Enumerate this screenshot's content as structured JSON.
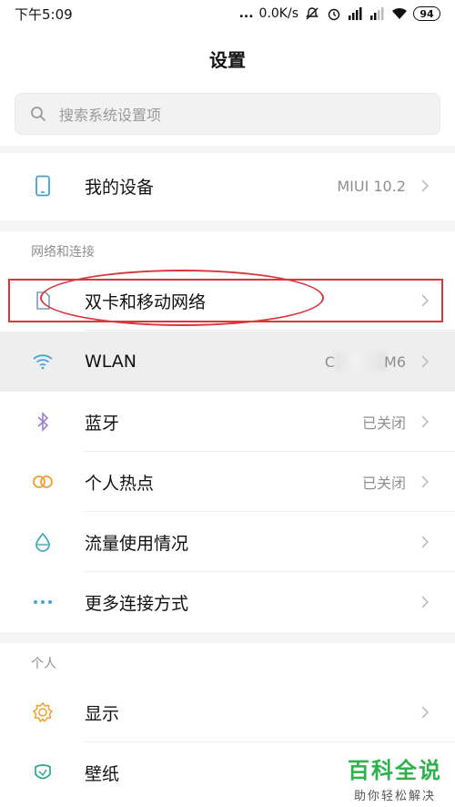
{
  "statusbar": {
    "time": "下午5:09",
    "dots": "...",
    "speed": "0.0K/s",
    "battery": "94"
  },
  "page": {
    "title": "设置"
  },
  "search": {
    "placeholder": "搜索系统设置项"
  },
  "device": {
    "label": "我的设备",
    "value": "MIUI 10.2"
  },
  "network": {
    "header": "网络和连接",
    "items": [
      {
        "label": "双卡和移动网络",
        "value": ""
      },
      {
        "label": "WLAN",
        "value_left": "C",
        "value_right": "M6"
      },
      {
        "label": "蓝牙",
        "value": "已关闭"
      },
      {
        "label": "个人热点",
        "value": "已关闭"
      },
      {
        "label": "流量使用情况",
        "value": ""
      },
      {
        "label": "更多连接方式",
        "value": ""
      }
    ]
  },
  "personal": {
    "header": "个人",
    "items": [
      {
        "label": "显示"
      },
      {
        "label": "壁纸"
      }
    ]
  },
  "watermark": {
    "title": "百科全说",
    "subtitle": "助你轻松解决"
  },
  "colors": {
    "accent_red": "#d9363e",
    "wifi_icon": "#4aa3d8",
    "bluetooth_icon": "#9b7fd6",
    "hotspot_icon": "#f0a030",
    "watermark_green": "#2db14c"
  }
}
